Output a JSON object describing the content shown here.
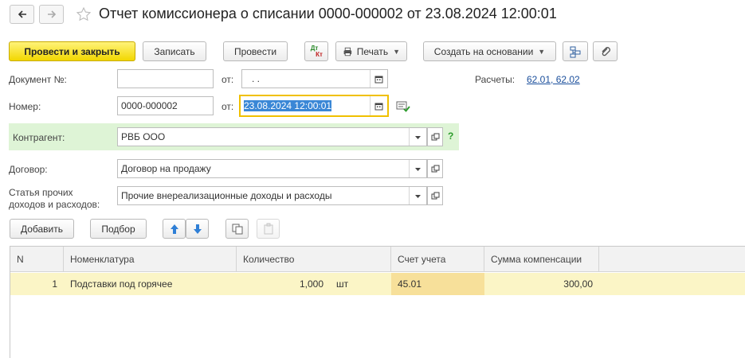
{
  "window": {
    "title": "Отчет комиссионера о списании 0000-000002 от 23.08.2024 12:00:01"
  },
  "toolbar": {
    "post_close": "Провести и закрыть",
    "save": "Записать",
    "post": "Провести",
    "dtkt_top": "Дт",
    "dtkt_bottom": "Кт",
    "print": "Печать",
    "create_based": "Создать на основании"
  },
  "form": {
    "doc_no_label": "Документ №:",
    "doc_no_value": "",
    "from_label": "от:",
    "doc_date_value": " .  .",
    "number_label": "Номер:",
    "number_value": "0000-000002",
    "from_label2": "от:",
    "date_value": "23.08.2024 12:00:01",
    "accounts_label": "Расчеты:",
    "accounts_value": "62.01, 62.02",
    "counterparty_label": "Контрагент:",
    "counterparty_value": "РВБ ООО",
    "help_mark": "?",
    "contract_label": "Договор:",
    "contract_value": "Договор на продажу",
    "article_label_1": "Статья прочих",
    "article_label_2": "доходов и расходов:",
    "article_value": "Прочие внереализационные доходы и расходы"
  },
  "table_toolbar": {
    "add": "Добавить",
    "pick": "Подбор"
  },
  "table": {
    "headers": {
      "n": "N",
      "item": "Номенклатура",
      "qty": "Количество",
      "account": "Счет учета",
      "sum": "Сумма компенсации"
    },
    "rows": [
      {
        "n": "1",
        "item": "Подставки под горячее",
        "qty": "1,000",
        "unit": "шт",
        "account": "45.01",
        "sum": "300,00"
      }
    ]
  }
}
